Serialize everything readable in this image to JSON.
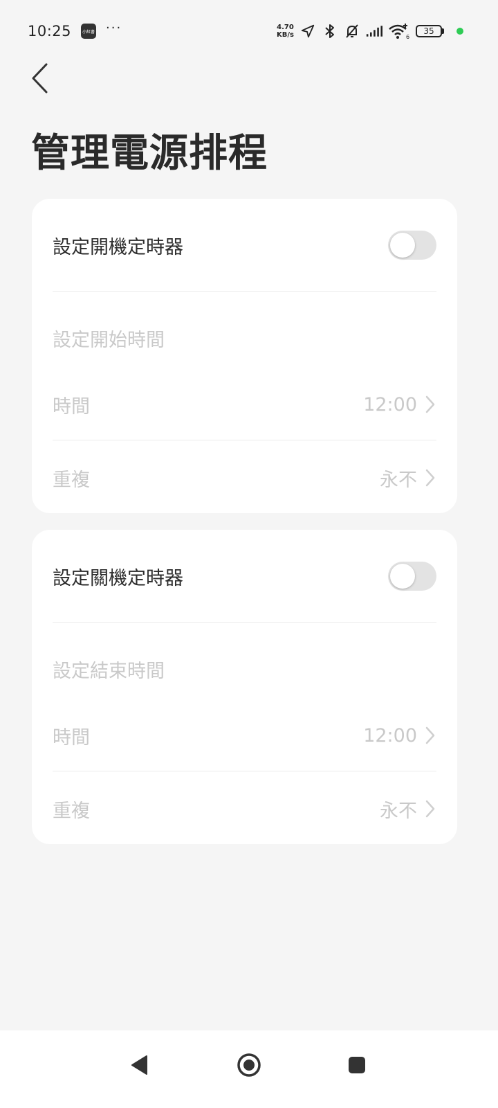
{
  "status_bar": {
    "time": "10:25",
    "app_icon_text": "小紅書",
    "more_indicator": "···",
    "net_speed_value": "4.70",
    "net_speed_unit": "KB/s",
    "icons": [
      "location-arrow-icon",
      "bluetooth-icon",
      "bell-muted-icon",
      "signal-bars-icon",
      "wifi-6-icon"
    ],
    "battery_level": "35",
    "privacy_dot_color": "#2ecc55"
  },
  "header": {
    "title": "管理電源排程"
  },
  "power_on": {
    "toggle_label": "設定開機定時器",
    "toggle_on": false,
    "section_label": "設定開始時間",
    "time_label": "時間",
    "time_value": "12:00",
    "repeat_label": "重複",
    "repeat_value": "永不"
  },
  "power_off": {
    "toggle_label": "設定關機定時器",
    "toggle_on": false,
    "section_label": "設定結束時間",
    "time_label": "時間",
    "time_value": "12:00",
    "repeat_label": "重複",
    "repeat_value": "永不"
  },
  "nav": {
    "icons": [
      "back-triangle-icon",
      "home-circle-icon",
      "recent-square-icon"
    ]
  },
  "colors": {
    "background": "#f5f5f5",
    "card": "#ffffff",
    "disabled_text": "#c9c9c9",
    "toggle_off": "#e3e3e3"
  }
}
